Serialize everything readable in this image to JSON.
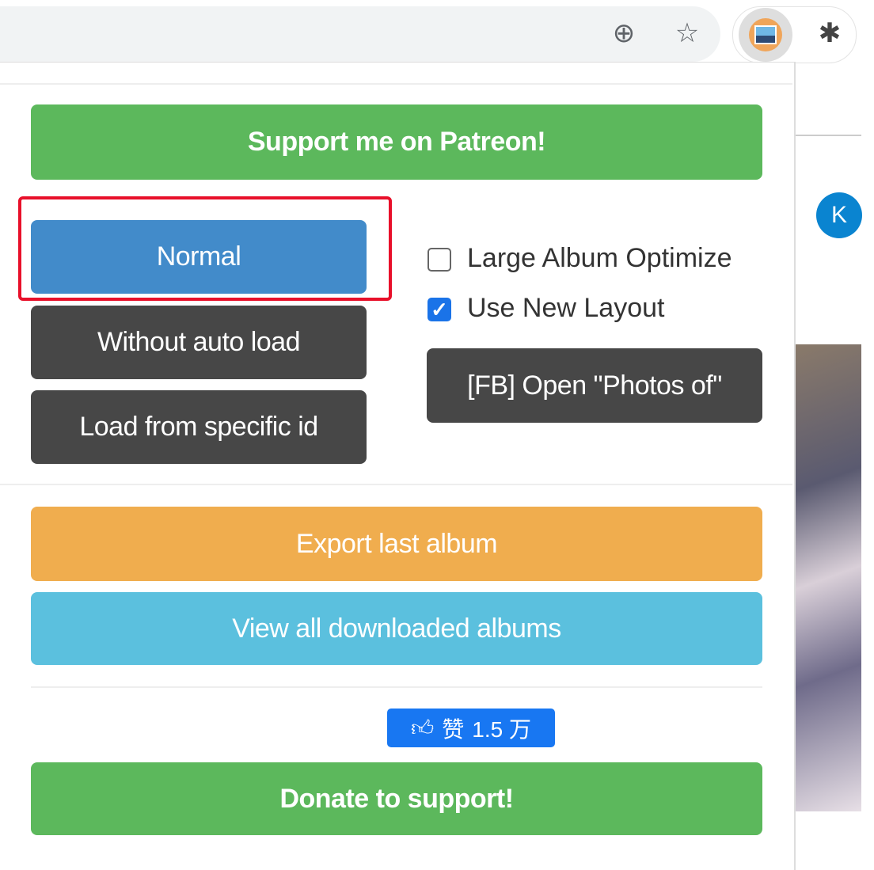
{
  "browser": {
    "icons": [
      "add-circle-icon",
      "bookmark-star-icon",
      "extension-photo-icon",
      "extensions-puzzle-icon"
    ]
  },
  "page_background": {
    "avatar_letter": "K"
  },
  "popup": {
    "patreon_label": "Support me on Patreon!",
    "normal_label": "Normal",
    "without_auto_load_label": "Without auto load",
    "load_specific_label": "Load from specific id",
    "large_album_label": "Large Album Optimize",
    "large_album_checked": false,
    "new_layout_label": "Use New Layout",
    "new_layout_checked": true,
    "fb_photos_label": "[FB] Open \"Photos of\"",
    "export_label": "Export last album",
    "view_all_label": "View all downloaded albums",
    "like_label": "赞",
    "like_count": "1.5 万",
    "donate_label": "Donate to support!"
  },
  "colors": {
    "green": "#5cb85c",
    "blue": "#428bca",
    "dark": "#474747",
    "orange": "#f0ad4e",
    "cyan": "#5bc0de",
    "highlight": "#e8102a",
    "facebook": "#1877f2"
  }
}
